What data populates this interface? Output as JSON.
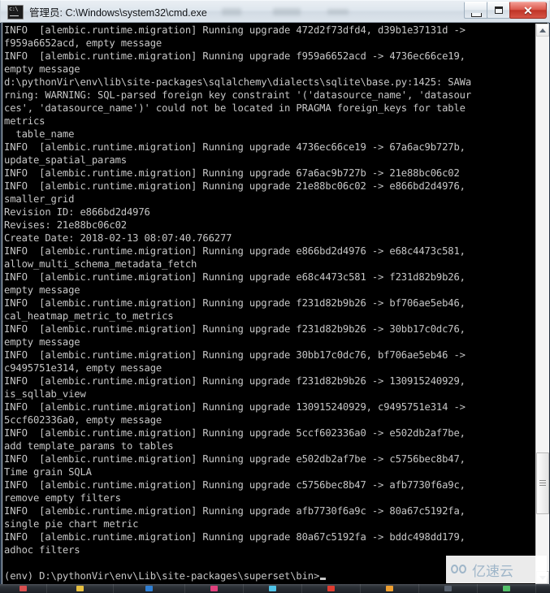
{
  "window": {
    "title": "管理员: C:\\Windows\\system32\\cmd.exe",
    "icon": "console-icon",
    "controls": {
      "minimize_label": "Minimize",
      "maximize_label": "Maximize",
      "close_label": "✕"
    }
  },
  "console": {
    "background_color": "#000000",
    "text_color": "#c8c8c8",
    "lines": [
      "INFO  [alembic.runtime.migration] Running upgrade 472d2f73dfd4, d39b1e37131d ->",
      "f959a6652acd, empty message",
      "INFO  [alembic.runtime.migration] Running upgrade f959a6652acd -> 4736ec66ce19,",
      "empty message",
      "d:\\pythonVir\\env\\lib\\site-packages\\sqlalchemy\\dialects\\sqlite\\base.py:1425: SAWa",
      "rning: WARNING: SQL-parsed foreign key constraint '('datasource_name', 'datasour",
      "ces', 'datasource_name')' could not be located in PRAGMA foreign_keys for table",
      "metrics",
      "  table_name",
      "INFO  [alembic.runtime.migration] Running upgrade 4736ec66ce19 -> 67a6ac9b727b,",
      "update_spatial_params",
      "INFO  [alembic.runtime.migration] Running upgrade 67a6ac9b727b -> 21e88bc06c02",
      "INFO  [alembic.runtime.migration] Running upgrade 21e88bc06c02 -> e866bd2d4976,",
      "smaller_grid",
      "Revision ID: e866bd2d4976",
      "Revises: 21e88bc06c02",
      "Create Date: 2018-02-13 08:07:40.766277",
      "INFO  [alembic.runtime.migration] Running upgrade e866bd2d4976 -> e68c4473c581,",
      "allow_multi_schema_metadata_fetch",
      "INFO  [alembic.runtime.migration] Running upgrade e68c4473c581 -> f231d82b9b26,",
      "empty message",
      "INFO  [alembic.runtime.migration] Running upgrade f231d82b9b26 -> bf706ae5eb46,",
      "cal_heatmap_metric_to_metrics",
      "INFO  [alembic.runtime.migration] Running upgrade f231d82b9b26 -> 30bb17c0dc76,",
      "empty message",
      "INFO  [alembic.runtime.migration] Running upgrade 30bb17c0dc76, bf706ae5eb46 ->",
      "c9495751e314, empty message",
      "INFO  [alembic.runtime.migration] Running upgrade f231d82b9b26 -> 130915240929,",
      "is_sqllab_view",
      "INFO  [alembic.runtime.migration] Running upgrade 130915240929, c9495751e314 ->",
      "5ccf602336a0, empty message",
      "INFO  [alembic.runtime.migration] Running upgrade 5ccf602336a0 -> e502db2af7be,",
      "add template_params to tables",
      "INFO  [alembic.runtime.migration] Running upgrade e502db2af7be -> c5756bec8b47,",
      "Time grain SQLA",
      "INFO  [alembic.runtime.migration] Running upgrade c5756bec8b47 -> afb7730f6a9c,",
      "remove empty filters",
      "INFO  [alembic.runtime.migration] Running upgrade afb7730f6a9c -> 80a67c5192fa,",
      "single pie chart metric",
      "INFO  [alembic.runtime.migration] Running upgrade 80a67c5192fa -> bddc498dd179,",
      "adhoc filters",
      "",
      "(env) D:\\pythonVir\\env\\Lib\\site-packages\\superset\\bin>"
    ],
    "prompt_line_index": 42,
    "cursor_visible": true
  },
  "scrollbar": {
    "up_arrow": "scroll-up-arrow",
    "down_arrow": "scroll-down-arrow",
    "thumb_position_percent": 88
  },
  "taskbar": {
    "items": [
      {
        "name": "taskbar-item-1",
        "color": "#d94f4f",
        "width": 58
      },
      {
        "name": "taskbar-item-2",
        "color": "#e8c040",
        "width": 82
      },
      {
        "name": "taskbar-item-3",
        "color": "#2f7fd4",
        "width": 88
      },
      {
        "name": "taskbar-item-4",
        "color": "#e0407c",
        "width": 72
      },
      {
        "name": "taskbar-item-5",
        "color": "#4fc3e8",
        "width": 72
      },
      {
        "name": "taskbar-item-6",
        "color": "#e03b2f",
        "width": 72
      },
      {
        "name": "taskbar-item-7",
        "color": "#f0a030",
        "width": 72
      },
      {
        "name": "taskbar-item-8",
        "color": "#5a6370",
        "width": 72
      },
      {
        "name": "taskbar-item-9",
        "color": "#54c06a",
        "width": 72
      },
      {
        "name": "taskbar-item-10",
        "color": "#6d7580",
        "width": 72
      }
    ]
  },
  "watermark": {
    "text": "亿速云",
    "logo": "cloud-logo-icon",
    "color": "#9fb6c9"
  }
}
